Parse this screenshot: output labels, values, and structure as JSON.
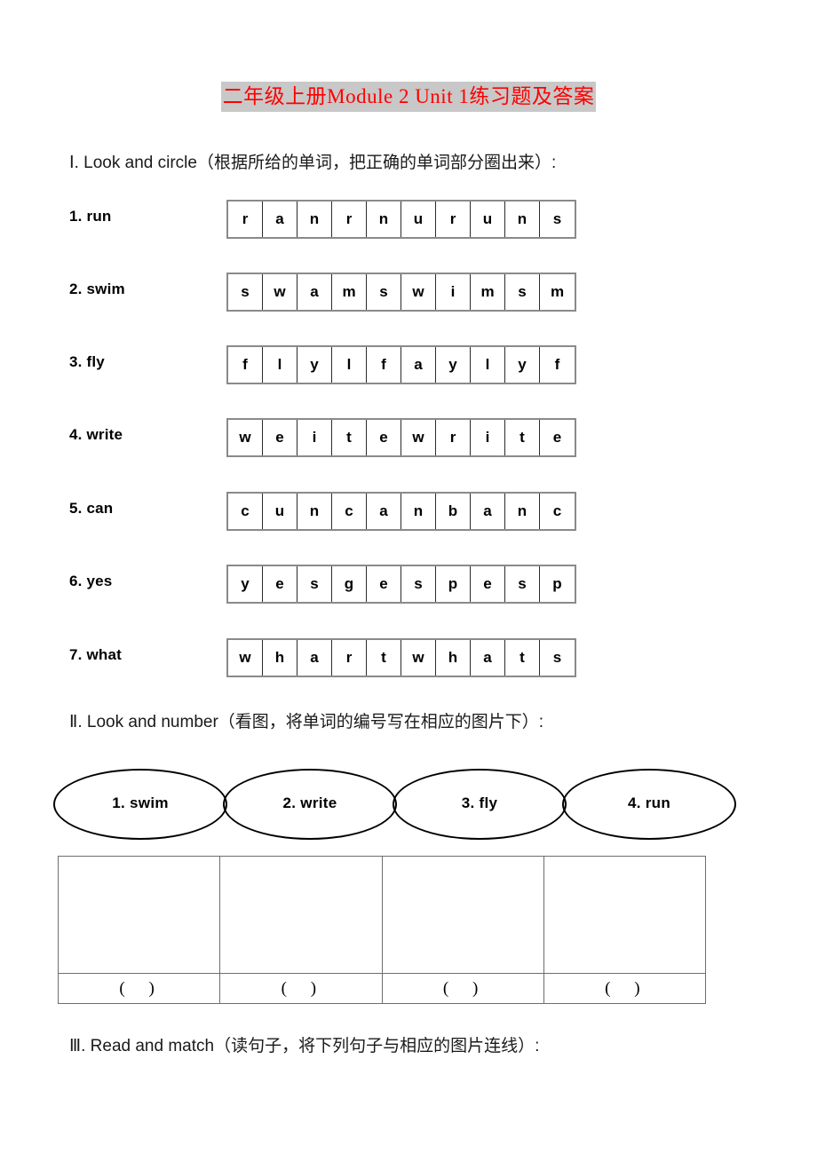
{
  "document": {
    "title": "二年级上册Module 2 Unit 1练习题及答案",
    "title_color": "#ff0000",
    "title_highlight_color": "#c8c8c8"
  },
  "sections": [
    {
      "heading": "Ⅰ. Look and circle（根据所给的单词，把正确的单词部分圈出来）:",
      "rows": [
        {
          "label": "1. run",
          "letters": [
            "r",
            "a",
            "n",
            "r",
            "n",
            "u",
            "r",
            "u",
            "n",
            "s"
          ]
        },
        {
          "label": "2. swim",
          "letters": [
            "s",
            "w",
            "a",
            "m",
            "s",
            "w",
            "i",
            "m",
            "s",
            "m"
          ]
        },
        {
          "label": "3. fly",
          "letters": [
            "f",
            "l",
            "y",
            "l",
            "f",
            "a",
            "y",
            "l",
            "y",
            "f"
          ]
        },
        {
          "label": "4. write",
          "letters": [
            "w",
            "e",
            "i",
            "t",
            "e",
            "w",
            "r",
            "i",
            "t",
            "e"
          ]
        },
        {
          "label": "5. can",
          "letters": [
            "c",
            "u",
            "n",
            "c",
            "a",
            "n",
            "b",
            "a",
            "n",
            "c"
          ]
        },
        {
          "label": "6. yes",
          "letters": [
            "y",
            "e",
            "s",
            "g",
            "e",
            "s",
            "p",
            "e",
            "s",
            "p"
          ]
        },
        {
          "label": "7. what",
          "letters": [
            "w",
            "h",
            "a",
            "r",
            "t",
            "w",
            "h",
            "a",
            "t",
            "s"
          ]
        }
      ]
    },
    {
      "heading": "Ⅱ. Look and number（看图，将单词的编号写在相应的图片下）:",
      "ellipses": [
        "1. swim",
        "2. write",
        "3. fly",
        "4. run"
      ],
      "picture_cells": [
        "",
        "",
        "",
        ""
      ],
      "answer_blanks": [
        "( )",
        "( )",
        "( )",
        "( )"
      ]
    },
    {
      "heading": "Ⅲ. Read and match（读句子，将下列句子与相应的图片连线）:"
    }
  ]
}
